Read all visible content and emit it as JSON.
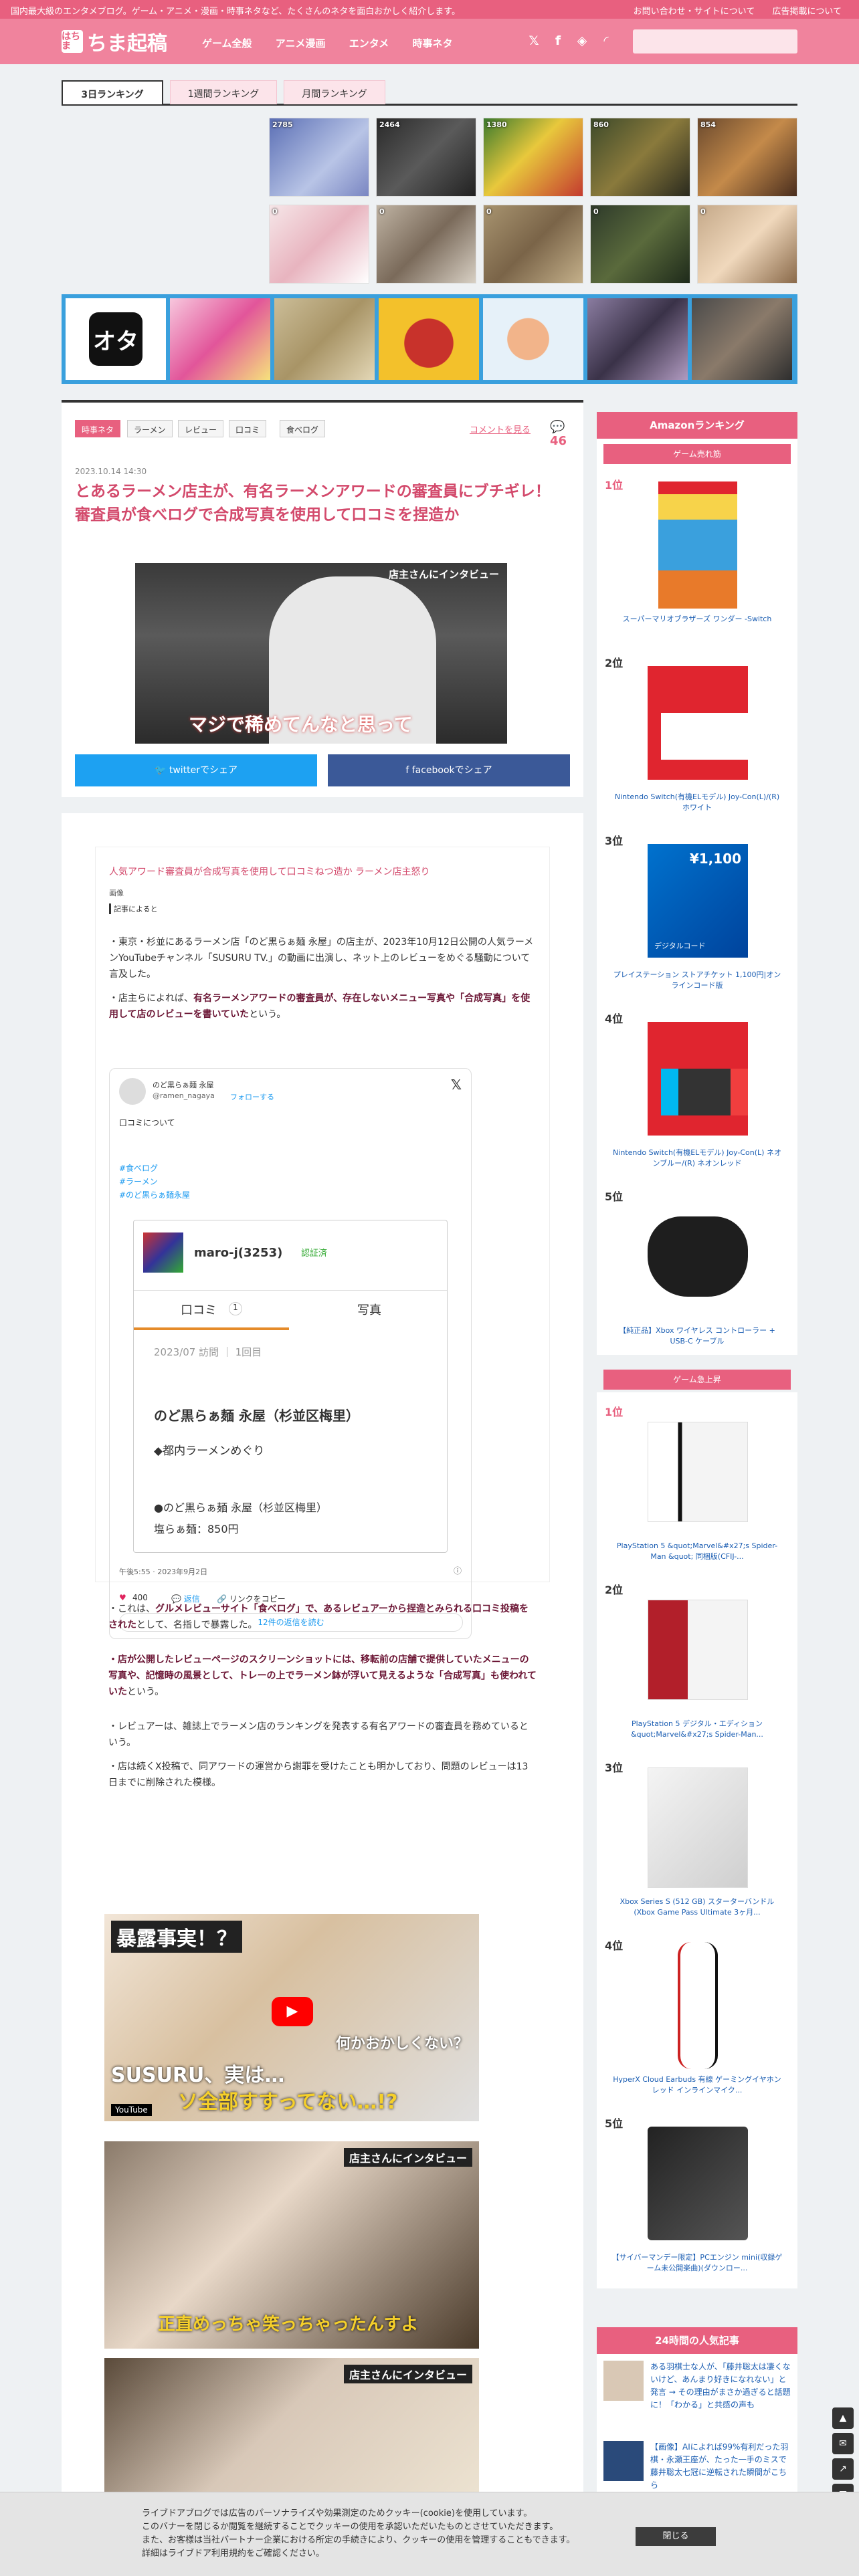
{
  "topstrip": {
    "tagline": "国内最大級のエンタメブログ。ゲーム・アニメ・漫画・時事ネタなど、たくさんのネタを面白おかしく紹介します。",
    "contact": "お問い合わせ・サイトについて",
    "ads": "広告掲載について"
  },
  "header": {
    "logo_mark": "はちま",
    "logo_text": "ちま起稿",
    "nav": [
      "ゲーム全般",
      "アニメ漫画",
      "エンタメ",
      "時事ネタ"
    ]
  },
  "tabs": [
    "3日ランキング",
    "1週間ランキング",
    "月間ランキング"
  ],
  "ranking_row1": [
    "2785",
    "2464",
    "1380",
    "860",
    "854"
  ],
  "ranking_row2": [
    "0",
    "0",
    "0",
    "0",
    "0"
  ],
  "article": {
    "tags": [
      "時事ネタ",
      "ラーメン",
      "レビュー",
      "口コミ",
      "食べログ"
    ],
    "comments_link": "コメントを見る",
    "comment_count": "46",
    "date": "2023.10.14 14:30",
    "title": "とあるラーメン店主が、有名ラーメンアワードの審査員にブチギレ！ 審査員が食べログで合成写真を使用して口コミを捏造か",
    "hero_caption_top": "店主さんにインタビュー",
    "hero_caption_bottom": "マジで稀めてんなと思って",
    "twitter_share": "twitterでシェア",
    "facebook_share": "facebookでシェア"
  },
  "body": {
    "summary": "人気アワード審査員が合成写真を使用して口コミねつ造か ラーメン店主怒り",
    "image_label": "画像",
    "source_label": "記事によると",
    "p1": "・東京・杉並にあるラーメン店「のど黒らぁ麺 永屋」の店主が、2023年10月12日公開の人気ラーメンYouTubeチャンネル「SUSURU TV.」の動画に出演し、ネット上のレビューをめぐる騒動について言及した。",
    "p2_pre": "・店主らによれば、",
    "p2_bold": "有名ラーメンアワードの審査員が、存在しないメニュー写真や「合成写真」を使用して店のレビューを書いていた",
    "p2_post": "という。",
    "tweet": {
      "handle": "@ramen_nagaya",
      "name": "のど黒らぁ麺 永屋",
      "follow": "フォローする",
      "body_top": "口コミについて",
      "tags": [
        "#食べログ",
        "#ラーメン",
        "#のど黒らぁ麺永屋"
      ],
      "reviewer": "maro-j(3253)",
      "verified": "認証済",
      "tab_review": "口コミ",
      "tab_review_count": "1",
      "tab_photo": "写真",
      "visit": "2023/07 訪問 ｜ 1回目",
      "shop": "のど黒らぁ麺 永屋（杉並区梅里）",
      "course": "◆都内ラーメンめぐり",
      "shop2": "●のど黒らぁ麺 永屋（杉並区梅里）",
      "price": "塩らぁ麺：850円",
      "time": "午後5:55 · 2023年9月2日",
      "likes": "400",
      "reply": "返信",
      "copy": "リンクをコピー",
      "more": "12件の返信を読む"
    },
    "p3_pre": "・これは、",
    "p3_bold": "グルメレビューサイト「食べログ」で、あるレビュアーから捏造とみられる口コミ投稿をされた",
    "p3_post": "として、名指しで暴露した。",
    "p4_bold": "・店が公開したレビューページのスクリーンショットには、移転前の店舗で提供していたメニューの写真や、記憶時の風景として、トレーの上でラーメン鉢が浮いて見えるような「合成写真」も使われていた",
    "p4_post": "という。",
    "p5": "・レビュアーは、雑誌上でラーメン店のランキングを発表する有名アワードの審査員を務めているという。",
    "p6": "・店は続くX投稿で、同アワードの運営から謝罪を受けたことも明かしており、問題のレビューは13日までに削除された模様。",
    "yt1_top": "暴露事実！？",
    "yt1_mid": "何かおかしくない？",
    "yt1_bottom": "SUSURU、実は…",
    "yt1_bottom2": "ソ全部すすってない…!?",
    "yt1_brand": "YouTube",
    "yt2_cap": "店主さんにインタビュー",
    "yt2_sub": "正直めっちゃ笑っちゃったんすよ",
    "yt3_cap": "店主さんにインタビュー"
  },
  "sidebar": {
    "amazon_title": "Amazonランキング",
    "game_title": "ゲーム売れ筋",
    "game_items": [
      {
        "rank": "1位",
        "name": "スーパーマリオブラザーズ ワンダー -Switch"
      },
      {
        "rank": "2位",
        "name": "Nintendo Switch(有機ELモデル) Joy-Con(L)/(R) ホワイト"
      },
      {
        "rank": "3位",
        "name": "プレイステーション ストアチケット 1,100円|オンラインコード版"
      },
      {
        "rank": "4位",
        "name": "Nintendo Switch(有機ELモデル) Joy-Con(L) ネオンブルー/(R) ネオンレッド"
      },
      {
        "rank": "5位",
        "name": "【純正品】Xbox ワイヤレス コントローラー + USB-C ケーブル"
      }
    ],
    "psn_price": "¥1,100",
    "psn_label": "デジタルコード",
    "rise_title": "ゲーム急上昇",
    "rise_items": [
      {
        "rank": "1位",
        "name": "PlayStation 5 &quot;Marvel&#x27;s Spider-Man &quot; 同梱版(CFIJ-..."
      },
      {
        "rank": "2位",
        "name": "PlayStation 5 デジタル・エディション &quot;Marvel&#x27;s Spider-Man..."
      },
      {
        "rank": "3位",
        "name": "Xbox Series S (512 GB) スターターバンドル (Xbox Game Pass Ultimate 3ヶ月..."
      },
      {
        "rank": "4位",
        "name": "HyperX Cloud Earbuds 有線 ゲーミングイヤホン レッド インラインマイク..."
      },
      {
        "rank": "5位",
        "name": "【サイバーマンデー限定】PCエンジン mini(収録ゲーム未公開楽曲)(ダウンロー..."
      }
    ],
    "popular_title": "24時間の人気記事",
    "popular": [
      "ある羽棋士な人が、「藤井聡太は凄くないけど、あんまり好きになれない」と発言 → その理由がまさか過ぎると話題に！「わかる」と共感の声も",
      "【画像】AIによれば99%有利だった羽棋・永瀬王座が、たった一手のミスで藤井聡太七冠に逆転された瞬間がこちら"
    ]
  },
  "cookie": {
    "line1": "ライブドアブログでは広告のパーソナライズや効果測定のためクッキー(cookie)を使用しています。",
    "line2": "このバナーを閉じるか閲覧を継続することでクッキーの使用を承認いただいたものとさせていただきます。",
    "line3": "また、お客様は当社パートナー企業における所定の手続きにより、クッキーの使用を管理することもできます。",
    "line4": "詳細はライブドア利用規約をご確認ください。",
    "close": "閉じる"
  }
}
